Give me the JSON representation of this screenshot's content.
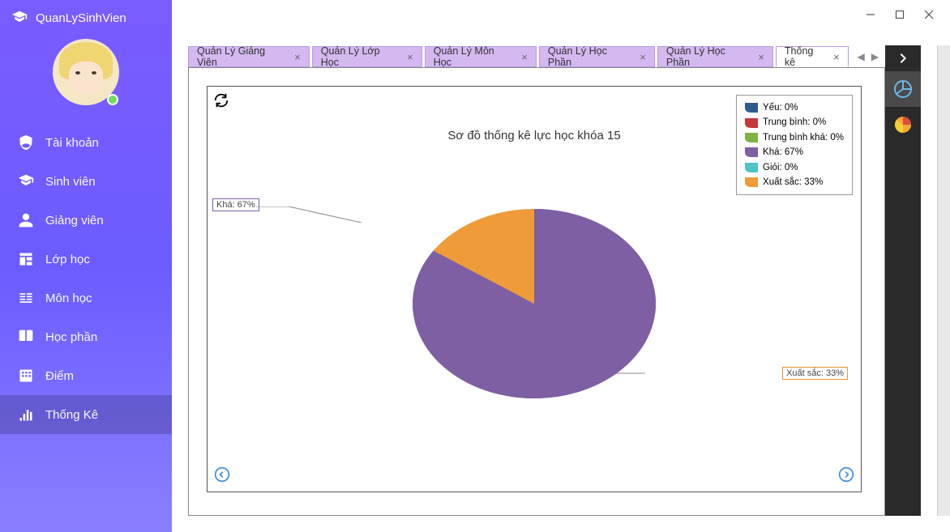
{
  "app": {
    "title": "QuanLySinhVien"
  },
  "sidebar": {
    "items": [
      {
        "label": "Tài khoản",
        "icon": "shield-user"
      },
      {
        "label": "Sinh viên",
        "icon": "grad-cap"
      },
      {
        "label": "Giảng viên",
        "icon": "person"
      },
      {
        "label": "Lớp học",
        "icon": "class"
      },
      {
        "label": "Môn học",
        "icon": "subject"
      },
      {
        "label": "Học phần",
        "icon": "book"
      },
      {
        "label": "Điểm",
        "icon": "score"
      },
      {
        "label": "Thống Kê",
        "icon": "stats"
      }
    ],
    "activeIndex": 7
  },
  "tabs": {
    "items": [
      {
        "label": "Quản Lý Giảng Viên"
      },
      {
        "label": "Quản Lý Lớp Học"
      },
      {
        "label": "Quản Lý Môn Học"
      },
      {
        "label": "Quản Lý Học Phần"
      },
      {
        "label": "Quản Lý Học Phần"
      },
      {
        "label": "Thống kê"
      }
    ],
    "activeIndex": 5
  },
  "chart_data": {
    "type": "pie",
    "title": "Sơ đồ thống kê lực học khóa 15",
    "series": [
      {
        "name": "Yếu",
        "value": 0,
        "label": "Yếu: 0%",
        "color": "#2e5b8f"
      },
      {
        "name": "Trung bình",
        "value": 0,
        "label": "Trung bình: 0%",
        "color": "#c23a3a"
      },
      {
        "name": "Trung bình khá",
        "value": 0,
        "label": "Trung bình khá: 0%",
        "color": "#7cb342"
      },
      {
        "name": "Khá",
        "value": 67,
        "label": "Khá: 67%",
        "color": "#7e5fa3"
      },
      {
        "name": "Giỏi",
        "value": 0,
        "label": "Giỏi: 0%",
        "color": "#4fc3c7"
      },
      {
        "name": "Xuất sắc",
        "value": 33,
        "label": "Xuất sắc: 33%",
        "color": "#ef9b3a"
      }
    ],
    "callouts": {
      "kha": "Khá: 67%",
      "xs": "Xuất sắc: 33%"
    }
  }
}
